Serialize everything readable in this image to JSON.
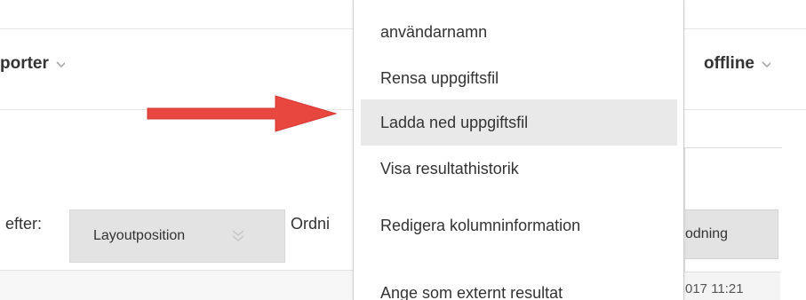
{
  "toolbar": {
    "reports_label": "porter",
    "offline_label": "offline"
  },
  "sort": {
    "label": "efter:",
    "select_value": "Layoutposition",
    "order_label": "Ordni"
  },
  "right_panel": {
    "button_label": "odning",
    "date_text": "017 11:21"
  },
  "dropdown": {
    "items": [
      {
        "label": "användarnamn",
        "highlighted": false
      },
      {
        "label": "Rensa uppgiftsfil",
        "highlighted": false
      },
      {
        "label": "Ladda ned uppgiftsfil",
        "highlighted": true
      },
      {
        "label": "Visa resultathistorik",
        "highlighted": false
      },
      {
        "label": "Redigera kolumninformation",
        "highlighted": false
      },
      {
        "label": "Ange som externt resultat",
        "highlighted": false
      }
    ]
  },
  "colors": {
    "arrow": "#e8473f",
    "menu_highlight": "#e9e9e9",
    "button_bg": "#e3e3e3"
  },
  "icons": [
    "chevron-down-icon",
    "double-chevron-down-icon",
    "arrow-right-annotation"
  ]
}
